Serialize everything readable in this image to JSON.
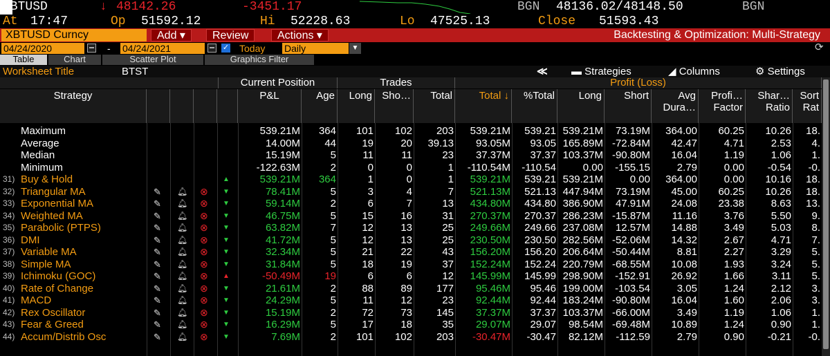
{
  "ticker": {
    "symbol": "XBTUSD",
    "arrow": "↓",
    "last": "48142.26",
    "change": "-3451.17",
    "source": "BGN",
    "bid_ask": "48136.02/48148.50",
    "source2": "BGN"
  },
  "quote": {
    "at_label": "At",
    "time": "17:47",
    "op_label": "Op",
    "open": "51592.12",
    "hi_label": "Hi",
    "high": "52228.63",
    "lo_label": "Lo",
    "low": "47525.13",
    "close_label": "Close",
    "close": "51593.43"
  },
  "toolbar": {
    "security": "XBTUSD Curncy",
    "add": "Add ▾",
    "review": "Review",
    "actions": "Actions ▾",
    "title": "Backtesting & Optimization: Multi-Strategy"
  },
  "dates": {
    "start": "04/24/2020",
    "sep": "-",
    "end": "04/24/2021",
    "today_label": "Today",
    "period": "Daily"
  },
  "tabs": [
    "Table",
    "Chart",
    "Scatter Plot",
    "Graphics Filter"
  ],
  "worksheet": {
    "label": "Worksheet Title",
    "value": "BTST",
    "collapse": "≪",
    "strategies": "Strategies",
    "columns": "Columns",
    "settings": "Settings"
  },
  "groups": {
    "current": "Current Position",
    "trades": "Trades",
    "profit": "Profit (Loss)"
  },
  "headers": {
    "strategy": "Strategy",
    "pl": "P&L",
    "age": "Age",
    "long": "Long",
    "short": "Sho…",
    "total": "Total",
    "ptotal": "Total ↓",
    "pcttotal": "%Total",
    "plong": "Long",
    "pshort": "Short",
    "avgdur": "Avg Dura…",
    "pf": "Profi… Factor",
    "sharpe": "Shar… Ratio",
    "sortino": "Sort Rat"
  },
  "stats": [
    {
      "name": "Maximum",
      "pl": "539.21M",
      "age": "364",
      "long": "101",
      "short": "102",
      "total": "203",
      "ptotal": "539.21M",
      "pct": "539.21",
      "plong": "539.21M",
      "pshort": "73.19M",
      "dur": "364.00",
      "pf": "60.25",
      "sh": "10.26",
      "so": "18."
    },
    {
      "name": "Average",
      "pl": "14.00M",
      "age": "44",
      "long": "19",
      "short": "20",
      "total": "39.13",
      "ptotal": "93.05M",
      "pct": "93.05",
      "plong": "165.89M",
      "pshort": "-72.84M",
      "dur": "42.47",
      "pf": "4.71",
      "sh": "2.53",
      "so": "4."
    },
    {
      "name": "Median",
      "pl": "15.19M",
      "age": "5",
      "long": "11",
      "short": "11",
      "total": "23",
      "ptotal": "37.37M",
      "pct": "37.37",
      "plong": "103.37M",
      "pshort": "-90.80M",
      "dur": "16.04",
      "pf": "1.19",
      "sh": "1.06",
      "so": "1."
    },
    {
      "name": "Minimum",
      "pl": "-122.63M",
      "age": "2",
      "long": "0",
      "short": "0",
      "total": "1",
      "ptotal": "-110.54M",
      "pct": "-110.54",
      "plong": "0.00",
      "pshort": "-155.15",
      "dur": "2.79",
      "pf": "0.00",
      "sh": "-0.54",
      "so": "-0."
    }
  ],
  "rows": [
    {
      "n": "31)",
      "name": "Buy & Hold",
      "icons": false,
      "dir": "up",
      "pl": "539.21M",
      "age": "364",
      "long": "1",
      "short": "0",
      "total": "1",
      "ptotal": "539.21M",
      "pct": "539.21",
      "plong": "539.21M",
      "pshort": "0.00",
      "dur": "364.00",
      "pf": "0.00",
      "sh": "10.16",
      "so": "18."
    },
    {
      "n": "32)",
      "name": "Triangular MA",
      "icons": true,
      "dir": "down",
      "pl": "78.41M",
      "age": "5",
      "long": "3",
      "short": "4",
      "total": "7",
      "ptotal": "521.13M",
      "pct": "521.13",
      "plong": "447.94M",
      "pshort": "73.19M",
      "dur": "45.00",
      "pf": "60.25",
      "sh": "10.26",
      "so": "18."
    },
    {
      "n": "33)",
      "name": "Exponential MA",
      "icons": true,
      "dir": "down",
      "pl": "59.14M",
      "age": "2",
      "long": "6",
      "short": "7",
      "total": "13",
      "ptotal": "434.80M",
      "pct": "434.80",
      "plong": "386.90M",
      "pshort": "47.91M",
      "dur": "24.08",
      "pf": "23.38",
      "sh": "8.63",
      "so": "13."
    },
    {
      "n": "34)",
      "name": "Weighted MA",
      "icons": true,
      "dir": "down",
      "pl": "46.75M",
      "age": "5",
      "long": "15",
      "short": "16",
      "total": "31",
      "ptotal": "270.37M",
      "pct": "270.37",
      "plong": "286.23M",
      "pshort": "-15.87M",
      "dur": "11.16",
      "pf": "3.76",
      "sh": "5.50",
      "so": "9."
    },
    {
      "n": "35)",
      "name": "Parabolic (PTPS)",
      "icons": true,
      "dir": "down",
      "pl": "63.82M",
      "age": "7",
      "long": "12",
      "short": "13",
      "total": "25",
      "ptotal": "249.66M",
      "pct": "249.66",
      "plong": "237.08M",
      "pshort": "12.57M",
      "dur": "14.88",
      "pf": "3.49",
      "sh": "5.03",
      "so": "8."
    },
    {
      "n": "36)",
      "name": "DMI",
      "icons": true,
      "dir": "down",
      "pl": "41.72M",
      "age": "5",
      "long": "12",
      "short": "13",
      "total": "25",
      "ptotal": "230.50M",
      "pct": "230.50",
      "plong": "282.56M",
      "pshort": "-52.06M",
      "dur": "14.32",
      "pf": "2.67",
      "sh": "4.71",
      "so": "7."
    },
    {
      "n": "37)",
      "name": "Variable MA",
      "icons": true,
      "dir": "down",
      "pl": "32.34M",
      "age": "5",
      "long": "21",
      "short": "22",
      "total": "43",
      "ptotal": "156.20M",
      "pct": "156.20",
      "plong": "206.64M",
      "pshort": "-50.44M",
      "dur": "8.81",
      "pf": "2.27",
      "sh": "3.29",
      "so": "5."
    },
    {
      "n": "38)",
      "name": "Simple MA",
      "icons": true,
      "dir": "down",
      "pl": "31.84M",
      "age": "5",
      "long": "18",
      "short": "19",
      "total": "37",
      "ptotal": "152.24M",
      "pct": "152.24",
      "plong": "220.79M",
      "pshort": "-68.55M",
      "dur": "10.08",
      "pf": "1.93",
      "sh": "3.24",
      "so": "5."
    },
    {
      "n": "39)",
      "name": "Ichimoku (GOC)",
      "icons": true,
      "dir": "up",
      "pl": "-50.49M",
      "age": "19",
      "long": "6",
      "short": "6",
      "total": "12",
      "ptotal": "145.99M",
      "pct": "145.99",
      "plong": "298.90M",
      "pshort": "-152.91",
      "dur": "26.92",
      "pf": "1.66",
      "sh": "3.11",
      "so": "5."
    },
    {
      "n": "40)",
      "name": "Rate of Change",
      "icons": true,
      "dir": "down",
      "pl": "21.61M",
      "age": "2",
      "long": "88",
      "short": "89",
      "total": "177",
      "ptotal": "95.46M",
      "pct": "95.46",
      "plong": "199.00M",
      "pshort": "-103.54",
      "dur": "3.05",
      "pf": "1.24",
      "sh": "2.12",
      "so": "3."
    },
    {
      "n": "41)",
      "name": "MACD",
      "icons": true,
      "dir": "down",
      "pl": "24.29M",
      "age": "5",
      "long": "11",
      "short": "12",
      "total": "23",
      "ptotal": "92.44M",
      "pct": "92.44",
      "plong": "183.24M",
      "pshort": "-90.80M",
      "dur": "16.04",
      "pf": "1.60",
      "sh": "2.06",
      "so": "3."
    },
    {
      "n": "42)",
      "name": "Rex Oscillator",
      "icons": true,
      "dir": "down",
      "pl": "15.19M",
      "age": "2",
      "long": "72",
      "short": "73",
      "total": "145",
      "ptotal": "37.37M",
      "pct": "37.37",
      "plong": "103.37M",
      "pshort": "-66.00M",
      "dur": "3.49",
      "pf": "1.19",
      "sh": "1.06",
      "so": "1."
    },
    {
      "n": "43)",
      "name": "Fear & Greed",
      "icons": true,
      "dir": "down",
      "pl": "16.29M",
      "age": "5",
      "long": "17",
      "short": "18",
      "total": "35",
      "ptotal": "29.07M",
      "pct": "29.07",
      "plong": "98.54M",
      "pshort": "-69.48M",
      "dur": "10.89",
      "pf": "1.24",
      "sh": "0.90",
      "so": "1."
    },
    {
      "n": "44)",
      "name": "Accum/Distrib Osc",
      "icons": true,
      "dir": "down",
      "pl": "7.69M",
      "age": "2",
      "long": "101",
      "short": "102",
      "total": "203",
      "ptotal": "-30.47M",
      "pct": "-30.47",
      "plong": "82.12M",
      "pshort": "-112.59",
      "dur": "2.79",
      "pf": "0.90",
      "sh": "-0.21",
      "so": "-0."
    }
  ]
}
